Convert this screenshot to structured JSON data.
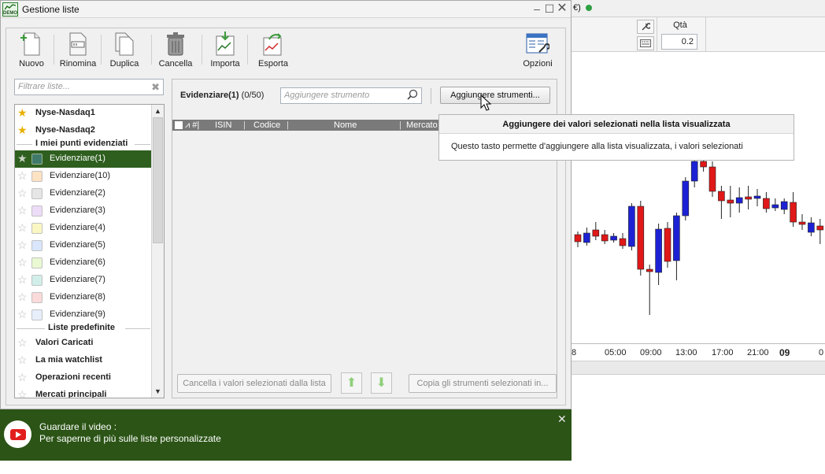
{
  "window": {
    "title": "Gestione liste"
  },
  "toolbar": {
    "new_label": "Nuovo",
    "rename_label": "Rinomina",
    "duplicate_label": "Duplica",
    "delete_label": "Cancella",
    "import_label": "Importa",
    "export_label": "Esporta",
    "options_label": "Opzioni"
  },
  "filter": {
    "placeholder": "Filtrare liste..."
  },
  "lists": {
    "top": [
      {
        "label": "Nyse-Nasdaq1"
      },
      {
        "label": "Nyse-Nasdaq2"
      }
    ],
    "section_highlights": "I miei punti evidenziati",
    "highlights": [
      {
        "label": "Evidenziare(1)",
        "color": "#3f7a6b",
        "selected": true
      },
      {
        "label": "Evidenziare(10)",
        "color": "#fde2c4"
      },
      {
        "label": "Evidenziare(2)",
        "color": "#e6e6e6"
      },
      {
        "label": "Evidenziare(3)",
        "color": "#ecdcf7"
      },
      {
        "label": "Evidenziare(4)",
        "color": "#fbf7c2"
      },
      {
        "label": "Evidenziare(5)",
        "color": "#d9e6fb"
      },
      {
        "label": "Evidenziare(6)",
        "color": "#eaf9d2"
      },
      {
        "label": "Evidenziare(7)",
        "color": "#d2eeea"
      },
      {
        "label": "Evidenziare(8)",
        "color": "#fadada"
      },
      {
        "label": "Evidenziare(9)",
        "color": "#e7effb"
      }
    ],
    "section_predefined": "Liste predefinite",
    "predefined": [
      {
        "label": "Valori Caricati"
      },
      {
        "label": "La mia watchlist"
      },
      {
        "label": "Operazioni recenti"
      },
      {
        "label": "Mercati principali"
      }
    ]
  },
  "content": {
    "list_name": "Evidenziare(1)",
    "list_count": "(0/50)",
    "instrument_placeholder": "Aggiungere strumento",
    "add_button": "Aggiungere strumenti...",
    "columns": {
      "flag": "⩘ #|",
      "isin": "ISIN",
      "code": "Codice",
      "name": "Nome",
      "market": "Mercato"
    },
    "delete_selected": "Cancella i valori selezionati dalla lista",
    "copy_selected": "Copia gli strumenti selezionati in..."
  },
  "tooltip": {
    "title": "Aggiungere dei valori selezionati nella lista visualizzata",
    "body": "Questo tasto permette d'aggiungere alla lista visualizzata, i valori selezionati"
  },
  "banner": {
    "line1": "Guardare il video :",
    "line2": "Per saperne di più sulle liste personalizzate"
  },
  "background_app": {
    "top_text": "€)",
    "qty_label": "Qtà",
    "qty_value": "0.2",
    "axis_labels": [
      "8",
      "05:00",
      "09:00",
      "13:00",
      "17:00",
      "21:00",
      "09",
      "0"
    ]
  },
  "chart_data": {
    "type": "candlestick",
    "up_color": "#1c22d4",
    "down_color": "#e01818",
    "candles": [
      {
        "o": 298,
        "c": 307,
        "h": 294,
        "l": 314,
        "up": false
      },
      {
        "o": 296,
        "c": 308,
        "h": 289,
        "l": 312,
        "up": true
      },
      {
        "o": 292,
        "c": 300,
        "h": 282,
        "l": 305,
        "up": false
      },
      {
        "o": 298,
        "c": 306,
        "h": 292,
        "l": 310,
        "up": false
      },
      {
        "o": 300,
        "c": 305,
        "h": 296,
        "l": 308,
        "up": true
      },
      {
        "o": 303,
        "c": 312,
        "h": 296,
        "l": 316,
        "up": false
      },
      {
        "o": 262,
        "c": 313,
        "h": 258,
        "l": 318,
        "up": true
      },
      {
        "o": 262,
        "c": 342,
        "h": 255,
        "l": 350,
        "up": false
      },
      {
        "o": 342,
        "c": 345,
        "h": 336,
        "l": 400,
        "up": false
      },
      {
        "o": 291,
        "c": 346,
        "h": 284,
        "l": 362,
        "up": true
      },
      {
        "o": 290,
        "c": 332,
        "h": 282,
        "l": 340,
        "up": false
      },
      {
        "o": 274,
        "c": 331,
        "h": 270,
        "l": 356,
        "up": true
      },
      {
        "o": 230,
        "c": 274,
        "h": 225,
        "l": 280,
        "up": true
      },
      {
        "o": 205,
        "c": 230,
        "h": 198,
        "l": 238,
        "up": true
      },
      {
        "o": 205,
        "c": 212,
        "h": 198,
        "l": 218,
        "up": false
      },
      {
        "o": 212,
        "c": 243,
        "h": 205,
        "l": 250,
        "up": false
      },
      {
        "o": 243,
        "c": 255,
        "h": 236,
        "l": 278,
        "up": false
      },
      {
        "o": 254,
        "c": 258,
        "h": 236,
        "l": 276,
        "up": false
      },
      {
        "o": 258,
        "c": 251,
        "h": 238,
        "l": 270,
        "up": true
      },
      {
        "o": 250,
        "c": 253,
        "h": 236,
        "l": 266,
        "up": false
      },
      {
        "o": 249,
        "c": 252,
        "h": 240,
        "l": 262,
        "up": true
      },
      {
        "o": 252,
        "c": 265,
        "h": 244,
        "l": 270,
        "up": false
      },
      {
        "o": 260,
        "c": 264,
        "h": 252,
        "l": 268,
        "up": true
      },
      {
        "o": 256,
        "c": 266,
        "h": 252,
        "l": 272,
        "up": true
      },
      {
        "o": 257,
        "c": 282,
        "h": 244,
        "l": 288,
        "up": false
      },
      {
        "o": 282,
        "c": 285,
        "h": 272,
        "l": 292,
        "up": false
      },
      {
        "o": 283,
        "c": 295,
        "h": 276,
        "l": 300,
        "up": true
      },
      {
        "o": 287,
        "c": 292,
        "h": 278,
        "l": 310,
        "up": false
      }
    ]
  }
}
